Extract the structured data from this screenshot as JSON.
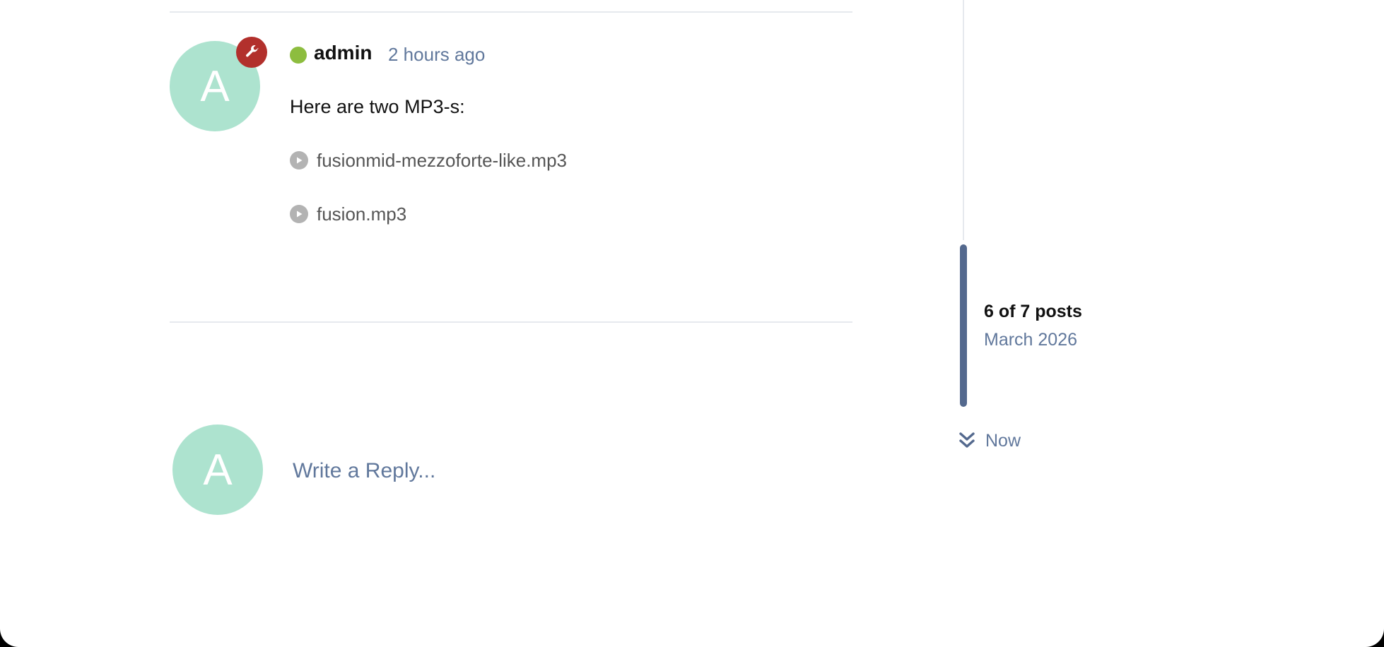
{
  "post": {
    "avatar_letter": "A",
    "author": "admin",
    "time_ago": "2 hours ago",
    "body": "Here are two MP3-s:",
    "attachments": [
      {
        "name": "fusionmid-mezzoforte-like.mp3",
        "icon": "play-icon"
      },
      {
        "name": "fusion.mp3",
        "icon": "play-icon"
      }
    ],
    "badge_icon": "wrench-icon",
    "status": "online"
  },
  "reply": {
    "avatar_letter": "A",
    "placeholder": "Write a Reply..."
  },
  "timeline": {
    "position_label": "6 of 7 posts",
    "date_label": "March 2026",
    "now_label": "Now",
    "now_icon": "double-chevron-down-icon"
  },
  "colors": {
    "avatar_bg": "#ade3cf",
    "badge_bg": "#b2302c",
    "online": "#8dbd3f",
    "accent_text": "#61789c",
    "scrubber": "#54698e"
  }
}
